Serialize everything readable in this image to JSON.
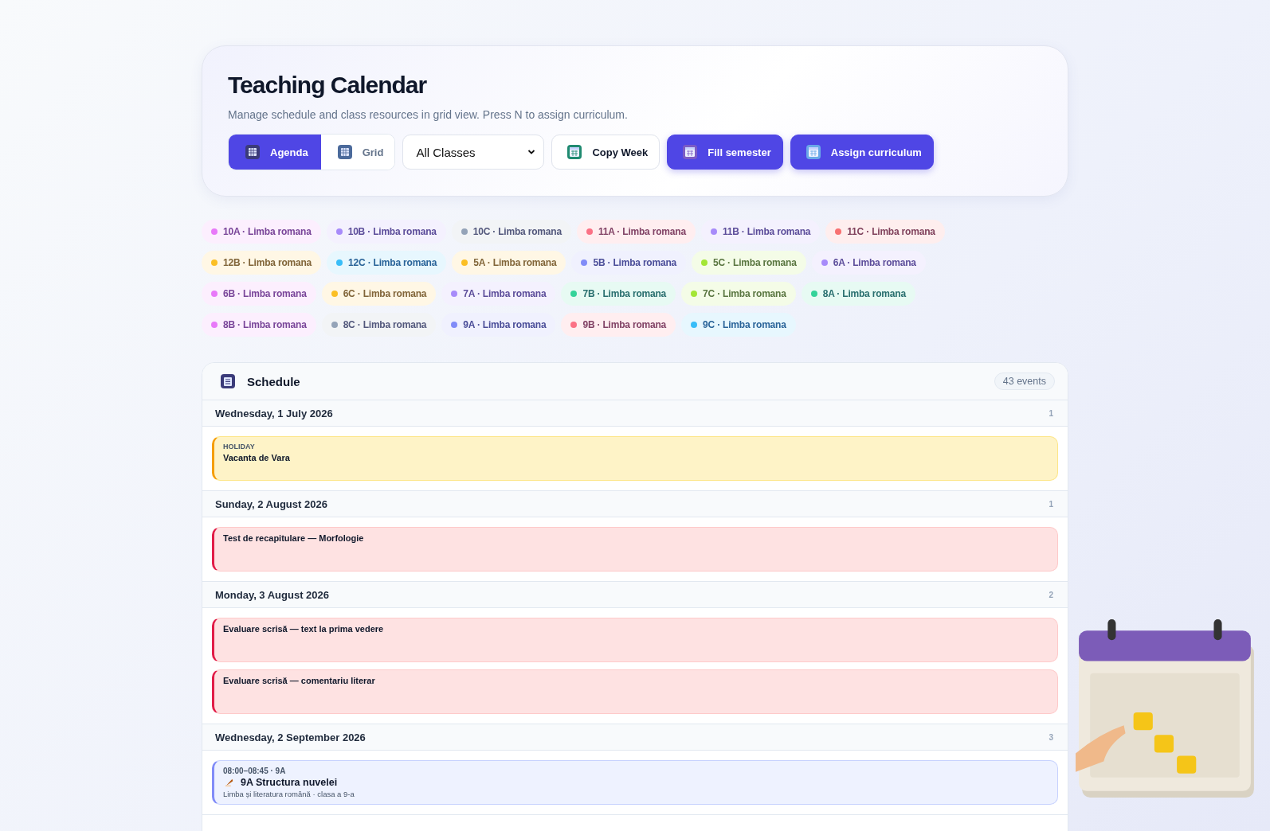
{
  "header": {
    "title": "Teaching Calendar",
    "subtitle": "Manage schedule and class resources in grid view. Press N to assign curriculum.",
    "view_toggle": [
      {
        "label": "Agenda",
        "kind": "agenda",
        "selected": true
      },
      {
        "label": "Grid",
        "kind": "grid",
        "selected": false
      }
    ],
    "class_filter": {
      "value": "All Classes"
    },
    "actions": [
      {
        "label": "Copy Week",
        "kind": "copy",
        "primary": false
      },
      {
        "label": "Fill semester",
        "kind": "fill",
        "primary": true
      },
      {
        "label": "Assign curriculum",
        "kind": "assign",
        "primary": true
      }
    ]
  },
  "class_chips": [
    {
      "label": "10A · Limba romana",
      "color": "#e879f9"
    },
    {
      "label": "10B · Limba romana",
      "color": "#a78bfa"
    },
    {
      "label": "10C · Limba romana",
      "color": "#94a3b8"
    },
    {
      "label": "11A · Limba romana",
      "color": "#fb7185"
    },
    {
      "label": "11B · Limba romana",
      "color": "#a78bfa"
    },
    {
      "label": "11C · Limba romana",
      "color": "#f87171"
    },
    {
      "label": "12B · Limba romana",
      "color": "#fbbf24"
    },
    {
      "label": "12C · Limba romana",
      "color": "#38bdf8"
    },
    {
      "label": "5A · Limba romana",
      "color": "#fbbf24"
    },
    {
      "label": "5B · Limba romana",
      "color": "#818cf8"
    },
    {
      "label": "5C · Limba romana",
      "color": "#a3e635"
    },
    {
      "label": "6A · Limba romana",
      "color": "#a78bfa"
    },
    {
      "label": "6B · Limba romana",
      "color": "#e879f9"
    },
    {
      "label": "6C · Limba romana",
      "color": "#fbbf24"
    },
    {
      "label": "7A · Limba romana",
      "color": "#a78bfa"
    },
    {
      "label": "7B · Limba romana",
      "color": "#34d399"
    },
    {
      "label": "7C · Limba romana",
      "color": "#a3e635"
    },
    {
      "label": "8A · Limba romana",
      "color": "#34d399"
    },
    {
      "label": "8B · Limba romana",
      "color": "#e879f9"
    },
    {
      "label": "8C · Limba romana",
      "color": "#94a3b8"
    },
    {
      "label": "9A · Limba romana",
      "color": "#818cf8"
    },
    {
      "label": "9B · Limba romana",
      "color": "#fb7185"
    },
    {
      "label": "9C · Limba romana",
      "color": "#38bdf8"
    }
  ],
  "schedule": {
    "title": "Schedule",
    "count": "43 events",
    "days": [
      {
        "date": "Wednesday, 1 July 2026",
        "count": "1",
        "events": [
          {
            "kind": "holiday",
            "tag": "HOLIDAY",
            "title": "Vacanta de Vara"
          }
        ]
      },
      {
        "date": "Sunday, 2 August 2026",
        "count": "1",
        "events": [
          {
            "kind": "test",
            "title": "Test de recapitulare — Morfologie"
          }
        ]
      },
      {
        "date": "Monday, 3 August 2026",
        "count": "2",
        "events": [
          {
            "kind": "test",
            "title": "Evaluare scrisă — text la prima vedere"
          },
          {
            "kind": "test",
            "title": "Evaluare scrisă — comentariu literar"
          }
        ]
      },
      {
        "date": "Wednesday, 2 September 2026",
        "count": "3",
        "events": [
          {
            "kind": "lesson",
            "time": "08:00–08:45 · 9A",
            "title": "9A Structura nuvelei",
            "subtitle": "Limba și literatura română · clasa a 9-a"
          }
        ]
      }
    ]
  }
}
